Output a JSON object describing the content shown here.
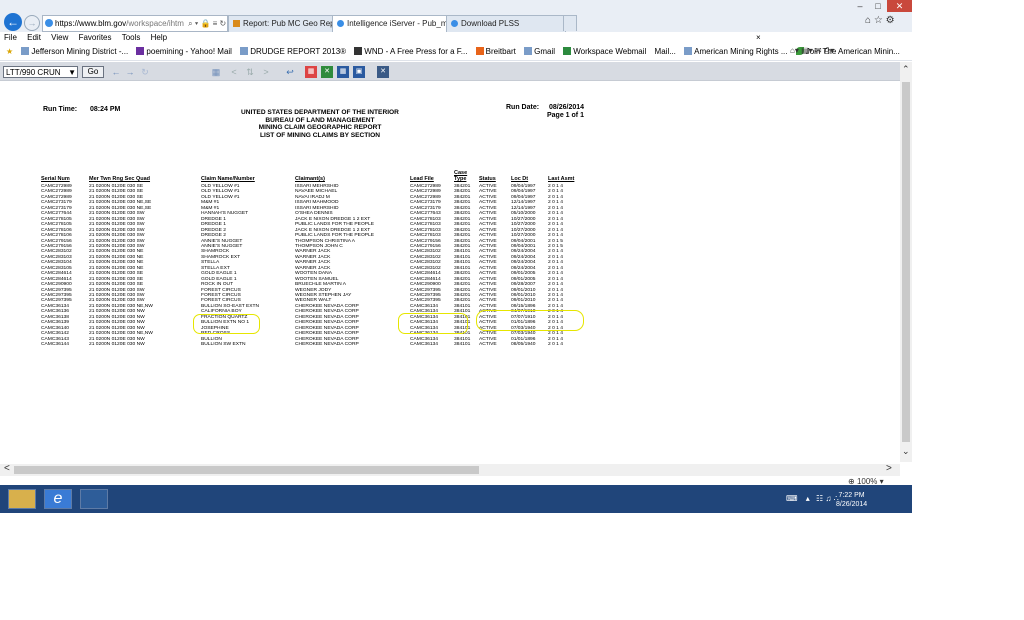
{
  "browser": {
    "address_domain": "https://www.blm.gov",
    "address_path": "/workspace/ihtm",
    "address_icons": "⌕ ▾ 🔒 ≡ ↻",
    "tabs": [
      {
        "label": "Report: Pub MC Geo Report"
      },
      {
        "label": "Intelligence iServer - Pub_m...  ×"
      },
      {
        "label": "Download PLSS"
      }
    ],
    "menu": [
      "File",
      "Edit",
      "View",
      "Favorites",
      "Tools",
      "Help"
    ],
    "favorites": [
      {
        "label": "Jefferson Mining District -..."
      },
      {
        "label": "poemining - Yahoo! Mail"
      },
      {
        "label": "DRUDGE REPORT 2013®"
      },
      {
        "label": "WND - A Free Press for a F..."
      },
      {
        "label": "Breitbart"
      },
      {
        "label": "Gmail"
      },
      {
        "label": "Workspace Webmail"
      },
      {
        "label": "Mail..."
      },
      {
        "label": "American Mining Rights ..."
      },
      {
        "label": "Join The American Minin..."
      }
    ],
    "close_x": "×",
    "zoom": "100%"
  },
  "toolbar": {
    "report_select": "LTT/990 CRUN",
    "go_label": "Go"
  },
  "taskbar": {
    "time": "7:22 PM",
    "date": "8/26/2014"
  },
  "report": {
    "run_time_label": "Run Time:",
    "run_time": "08:24 PM",
    "title_lines": [
      "UNITED STATES DEPARTMENT OF THE INTERIOR",
      "BUREAU OF LAND MANAGEMENT",
      "MINING CLAIM GEOGRAPHIC REPORT",
      "LIST OF MINING CLAIMS BY SECTION"
    ],
    "run_date_label": "Run Date:",
    "run_date": "08/26/2014",
    "page_info": "Page 1 of 1",
    "columns": [
      "Serial Num",
      "Mer Twn Rng Sec Quad",
      "Claim Name/Number",
      "Claimant(s)",
      "Lead File",
      "Case Type",
      "Status",
      "Loc Dt",
      "Last Asmt"
    ],
    "rows": [
      [
        "CAMC272989",
        "21 0200N 0120E 030 SE",
        "OLD YELLOW #1",
        "ISSARI MEHRSHID",
        "CAMC272989",
        "384201",
        "ACTIVE",
        "09/04/1997",
        "2 0 1 4"
      ],
      [
        "CAMC272989",
        "21 0200N 0120E 030 SE",
        "OLD YELLOW #1",
        "NAVAEE MICHAEL",
        "CAMC272989",
        "384201",
        "ACTIVE",
        "09/04/1997",
        "2 0 1 4"
      ],
      [
        "CAMC272989",
        "21 0200N 0120E 030 SE",
        "OLD YELLOW #1",
        "NAVAI IRADJ M",
        "CAMC272989",
        "384201",
        "ACTIVE",
        "09/04/1997",
        "2 0 1 4"
      ],
      [
        "CAMC273179",
        "21 0200N 0120E 030 NE,SE",
        "M&M #1",
        "ISSARI MAHMOOD",
        "CAMC273179",
        "384201",
        "ACTIVE",
        "12/14/1997",
        "2 0 1 4"
      ],
      [
        "CAMC273179",
        "21 0200N 0120E 030 NE,SE",
        "M&M #1",
        "ISSARI MEHRSHID",
        "CAMC273179",
        "384201",
        "ACTIVE",
        "12/14/1997",
        "2 0 1 4"
      ],
      [
        "CAMC277644",
        "21 0200N 0120E 030 SW",
        "HANNAH'S NUGGET",
        "O'SHEA DENNIS",
        "CAMC277643",
        "384201",
        "ACTIVE",
        "05/10/2000",
        "2 0 1 4"
      ],
      [
        "CAMC278105",
        "21 0200N 0120E 030 SW",
        "DREDGE 1",
        "JACK E NIXON DREDGE 1 2 EXT",
        "CAMC278103",
        "384201",
        "ACTIVE",
        "10/27/2000",
        "2 0 1 4"
      ],
      [
        "CAMC278105",
        "21 0200N 0120E 030 SW",
        "DREDGE 1",
        "PUBLIC LANDS FOR THE PEOPLE",
        "CAMC278103",
        "384201",
        "ACTIVE",
        "10/27/2000",
        "2 0 1 4"
      ],
      [
        "CAMC278106",
        "21 0200N 0120E 030 SW",
        "DREDGE 2",
        "JACK E NIXON DREDGE 1 2 EXT",
        "CAMC278103",
        "384201",
        "ACTIVE",
        "10/27/2000",
        "2 0 1 4"
      ],
      [
        "CAMC278106",
        "21 0200N 0120E 030 SW",
        "DREDGE 2",
        "PUBLIC LANDS FOR THE PEOPLE",
        "CAMC278103",
        "384201",
        "ACTIVE",
        "10/27/2000",
        "2 0 1 4"
      ],
      [
        "CAMC279156",
        "21 0200N 0120E 030 SW",
        "ANNIE'S NUGGET",
        "THOMPSON CHRISTINA A",
        "CAMC279156",
        "384201",
        "ACTIVE",
        "09/04/2001",
        "2 0 1 5"
      ],
      [
        "CAMC279156",
        "21 0200N 0120E 030 SW",
        "ANNIE'S NUGGET",
        "THOMPSON JOHN C",
        "CAMC279156",
        "384201",
        "ACTIVE",
        "09/04/2001",
        "2 0 1 5"
      ],
      [
        "CAMC283102",
        "21 0200N 0120E 030 NE",
        "SHAMROCK",
        "WARNER JACK",
        "CAMC283102",
        "384101",
        "ACTIVE",
        "09/24/2004",
        "2 0 1 4"
      ],
      [
        "CAMC283103",
        "21 0200N 0120E 030 NE",
        "SHAMROCK EXT",
        "WARNER JACK",
        "CAMC283102",
        "384101",
        "ACTIVE",
        "09/24/2004",
        "2 0 1 4"
      ],
      [
        "CAMC283104",
        "21 0200N 0120E 030 NE",
        "STELLA",
        "WARNER JACK",
        "CAMC283102",
        "384101",
        "ACTIVE",
        "09/24/2004",
        "2 0 1 4"
      ],
      [
        "CAMC283105",
        "21 0200N 0120E 030 NE",
        "STELLA EXT",
        "WARNER JACK",
        "CAMC283102",
        "384101",
        "ACTIVE",
        "09/24/2004",
        "2 0 1 4"
      ],
      [
        "CAMC284614",
        "21 0200N 0120E 030 SE",
        "GOLD EAGLE 1",
        "WOOTEN DANA",
        "CAMC284614",
        "384201",
        "ACTIVE",
        "09/01/2005",
        "2 0 1 4"
      ],
      [
        "CAMC284614",
        "21 0200N 0120E 030 SE",
        "GOLD EAGLE 1",
        "WOOTEN SAMUEL",
        "CAMC284614",
        "384201",
        "ACTIVE",
        "09/01/2005",
        "2 0 1 4"
      ],
      [
        "CAMC290900",
        "21 0200N 0120E 030 SE",
        "ROCK IN OUT",
        "BRUECHLE MARTIN A",
        "CAMC290900",
        "384201",
        "ACTIVE",
        "09/28/2007",
        "2 0 1 4"
      ],
      [
        "CAMC297395",
        "21 0200N 0120E 030 SW",
        "FOREST CIRCUS",
        "WEGNER JODY",
        "CAMC297395",
        "384201",
        "ACTIVE",
        "09/01/2010",
        "2 0 1 4"
      ],
      [
        "CAMC297395",
        "21 0200N 0120E 030 SW",
        "FOREST CIRCUS",
        "WEGNER STEPHEN JAY",
        "CAMC297395",
        "384201",
        "ACTIVE",
        "09/01/2010",
        "2 0 1 4"
      ],
      [
        "CAMC297395",
        "21 0200N 0120E 030 SW",
        "FOREST CIRCUS",
        "WEGNER WALT",
        "CAMC297395",
        "384201",
        "ACTIVE",
        "09/01/2010",
        "2 0 1 4"
      ],
      [
        "CAMC36134",
        "21 0200N 0120E 030 NE,NW",
        "BULLION SO-EAST EXTN",
        "CHEROKEE NEVADA CORP",
        "CAMC36134",
        "384101",
        "ACTIVE",
        "09/15/1896",
        "2 0 1 4"
      ],
      [
        "CAMC36136",
        "21 0200N 0120E 030 NW",
        "CALIFORNIA BOY",
        "CHEROKEE NEVADA CORP",
        "CAMC36134",
        "384101",
        "ACTIVE",
        "04/07/1910",
        "2 0 1 4"
      ],
      [
        "CAMC36138",
        "21 0200N 0120E 030 NW",
        "FRACTION QUARTZ",
        "CHEROKEE NEVADA CORP",
        "CAMC36134",
        "384101",
        "ACTIVE",
        "07/07/1910",
        "2 0 1 4"
      ],
      [
        "CAMC36139",
        "21 0200N 0120E 030 NW",
        "BULLION EXTN NO 1",
        "CHEROKEE NEVADA CORP",
        "CAMC36134",
        "384101",
        "ACTIVE",
        "01/01/1896",
        "2 0 1 4"
      ],
      [
        "CAMC36140",
        "21 0200N 0120E 030 NW",
        "JOSEPHINE",
        "CHEROKEE NEVADA CORP",
        "CAMC36134",
        "384101",
        "ACTIVE",
        "07/03/1940",
        "2 0 1 4"
      ],
      [
        "CAMC36142",
        "21 0200N 0120E 030 NE,NW",
        "RED CROSS",
        "CHEROKEE NEVADA CORP",
        "CAMC36134",
        "384101",
        "ACTIVE",
        "07/03/1940",
        "2 0 1 4"
      ],
      [
        "CAMC36143",
        "21 0200N 0120E 030 NW",
        "BULLION",
        "CHEROKEE NEVADA CORP",
        "CAMC36134",
        "384101",
        "ACTIVE",
        "01/01/1896",
        "2 0 1 4"
      ],
      [
        "CAMC36144",
        "21 0200N 0120E 030 NW",
        "BULLION SW EXTN",
        "CHEROKEE NEVADA CORP",
        "CAMC36134",
        "384101",
        "ACTIVE",
        "08/05/1940",
        "2 0 1 4"
      ]
    ]
  }
}
